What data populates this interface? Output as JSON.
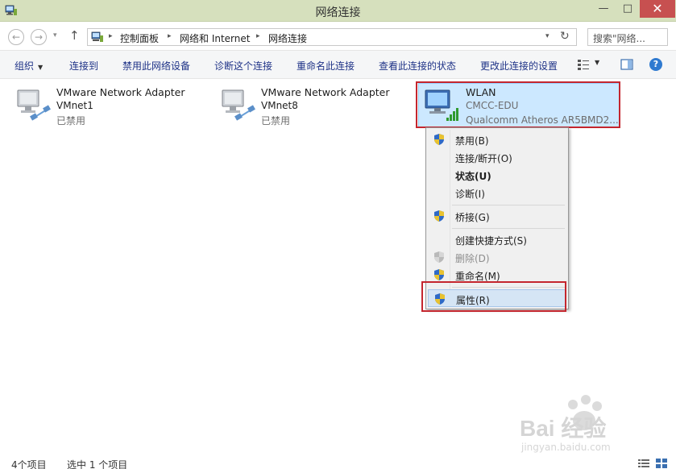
{
  "window": {
    "title": "网络连接",
    "controls": {
      "minimize": "—",
      "maximize": "□",
      "close": "✕"
    }
  },
  "navigation": {
    "back": "←",
    "forward": "→",
    "dropdown": "▾",
    "up": "↑",
    "breadcrumb": [
      "控制面板",
      "网络和 Internet",
      "网络连接"
    ],
    "crumb_separator": "▸",
    "address_dropdown": "▾",
    "refresh": "↻",
    "search_placeholder": "搜索\"网络..."
  },
  "command_bar": {
    "organize": "组织",
    "connect_to": "连接到",
    "disable_device": "禁用此网络设备",
    "diagnose": "诊断这个连接",
    "rename": "重命名此连接",
    "view_status": "查看此连接的状态",
    "change_settings": "更改此连接的设置",
    "help": "?"
  },
  "adapters": [
    {
      "name": "VMware Network Adapter",
      "line1": "VMnet1",
      "line2": "已禁用"
    },
    {
      "name": "VMware Network Adapter",
      "line1": "VMnet8",
      "line2": "已禁用"
    },
    {
      "name": "WLAN",
      "line1": "CMCC-EDU",
      "line2": "Qualcomm Atheros AR5BMD2..."
    }
  ],
  "context_menu": {
    "items": [
      {
        "label": "禁用(B)",
        "shield": true
      },
      {
        "label": "连接/断开(O)",
        "shield": false
      },
      {
        "label": "状态(U)",
        "shield": false,
        "bold": true
      },
      {
        "label": "诊断(I)",
        "shield": false
      },
      {
        "label": "桥接(G)",
        "shield": true
      },
      {
        "label": "创建快捷方式(S)",
        "shield": false
      },
      {
        "label": "删除(D)",
        "shield": true,
        "disabled": true
      },
      {
        "label": "重命名(M)",
        "shield": true
      },
      {
        "label": "属性(R)",
        "shield": true,
        "highlighted": true
      }
    ]
  },
  "status_bar": {
    "item_count": "4个项目",
    "selected": "选中 1 个项目"
  },
  "watermark": {
    "text": "Bai 经验",
    "url": "jingyan.baidu.com"
  },
  "colors": {
    "titlebar": "#d6e0bd",
    "selection": "#cce8ff",
    "highlight_box": "#c4262e",
    "close": "#c75050"
  }
}
